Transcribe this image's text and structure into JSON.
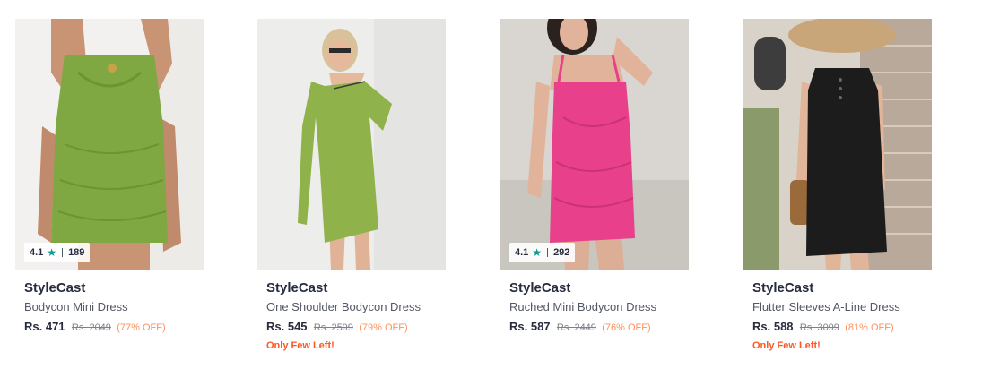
{
  "products": [
    {
      "brand": "StyleCast",
      "name": "Bodycon Mini Dress",
      "price": "Rs. 471",
      "mrp": "Rs. 2049",
      "discount": "(77% OFF)",
      "rating": "4.1",
      "rating_count": "189",
      "stock_note": "",
      "dress_color": "#7fa742"
    },
    {
      "brand": "StyleCast",
      "name": "One Shoulder Bodycon Dress",
      "price": "Rs. 545",
      "mrp": "Rs. 2599",
      "discount": "(79% OFF)",
      "rating": "",
      "rating_count": "",
      "stock_note": "Only Few Left!",
      "dress_color": "#8fb24a"
    },
    {
      "brand": "StyleCast",
      "name": "Ruched Mini Bodycon Dress",
      "price": "Rs. 587",
      "mrp": "Rs. 2449",
      "discount": "(76% OFF)",
      "rating": "4.1",
      "rating_count": "292",
      "stock_note": "",
      "dress_color": "#e8408a"
    },
    {
      "brand": "StyleCast",
      "name": "Flutter Sleeves A-Line Dress",
      "price": "Rs. 588",
      "mrp": "Rs. 3099",
      "discount": "(81% OFF)",
      "rating": "",
      "rating_count": "",
      "stock_note": "Only Few Left!",
      "dress_color": "#1c1c1c"
    }
  ],
  "colors": {
    "star": "#14958f",
    "discount": "#ff905a",
    "few_left": "#ff5722"
  }
}
